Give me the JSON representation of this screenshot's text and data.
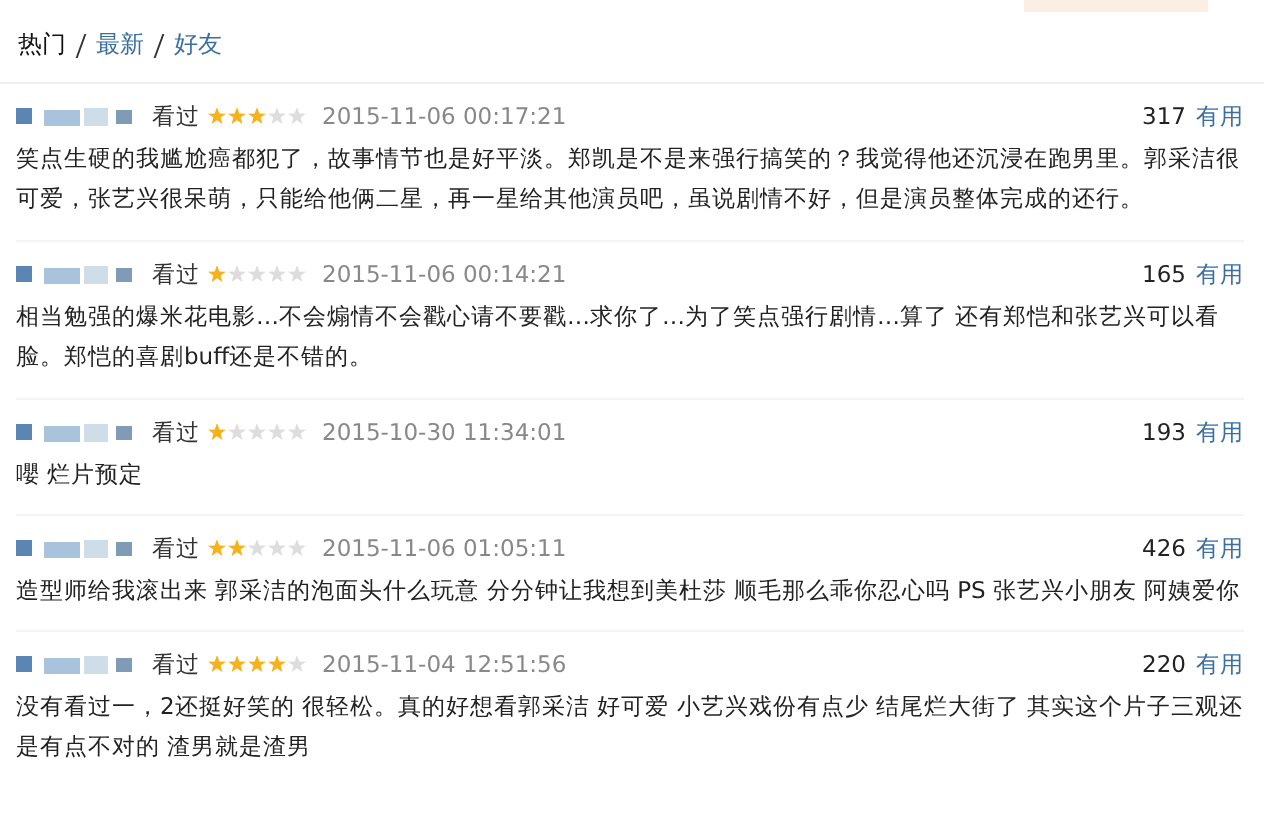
{
  "tabs": [
    {
      "label": "热门",
      "selected": true
    },
    {
      "label": "最新",
      "selected": false
    },
    {
      "label": "好友",
      "selected": false
    }
  ],
  "reviews": [
    {
      "status": "看过",
      "stars": 3,
      "time": "2015-11-06 00:17:21",
      "votes": "317",
      "useful": "有用",
      "text": "笑点生硬的我尴尬癌都犯了，故事情节也是好平淡。郑凯是不是来强行搞笑的？我觉得他还沉浸在跑男里。郭采洁很可爱，张艺兴很呆萌，只能给他俩二星，再一星给其他演员吧，虽说剧情不好，但是演员整体完成的还行。"
    },
    {
      "status": "看过",
      "stars": 1,
      "time": "2015-11-06 00:14:21",
      "votes": "165",
      "useful": "有用",
      "text": "相当勉强的爆米花电影…不会煽情不会戳心请不要戳…求你了…为了笑点强行剧情…算了 还有郑恺和张艺兴可以看脸。郑恺的喜剧buff还是不错的。"
    },
    {
      "status": "看过",
      "stars": 1,
      "time": "2015-10-30 11:34:01",
      "votes": "193",
      "useful": "有用",
      "text": "嚶 烂片预定"
    },
    {
      "status": "看过",
      "stars": 2,
      "time": "2015-11-06 01:05:11",
      "votes": "426",
      "useful": "有用",
      "text": "造型师给我滚出来 郭采洁的泡面头什么玩意 分分钟让我想到美杜莎 顺毛那么乖你忍心吗 PS 张艺兴小朋友 阿姨爱你"
    },
    {
      "status": "看过",
      "stars": 4,
      "time": "2015-11-04 12:51:56",
      "votes": "220",
      "useful": "有用",
      "text": "没有看过一，2还挺好笑的 很轻松。真的好想看郭采洁 好可爱 小艺兴戏份有点少 结尾烂大街了 其实这个片子三观还是有点不对的 渣男就是渣男"
    }
  ]
}
